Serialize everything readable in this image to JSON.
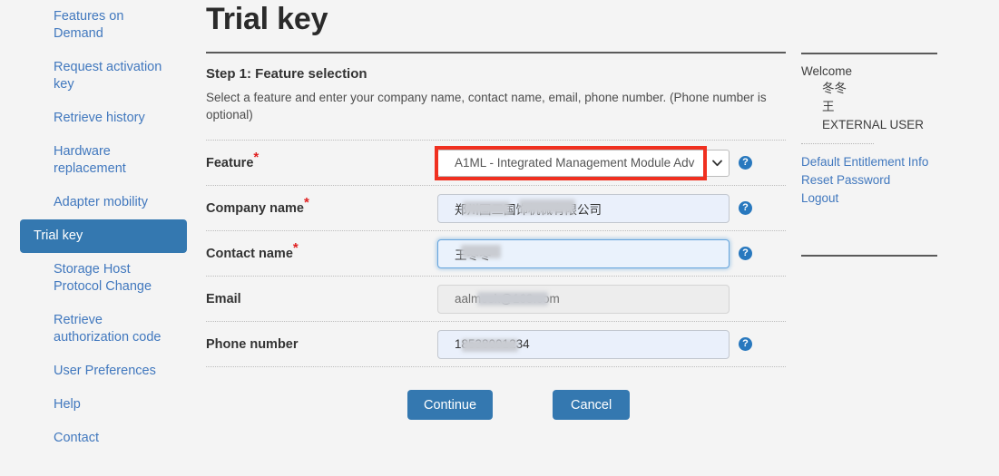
{
  "sidebar": {
    "items": [
      {
        "label": "Features on Demand",
        "active": false
      },
      {
        "label": "Request activation key",
        "active": false
      },
      {
        "label": "Retrieve history",
        "active": false
      },
      {
        "label": "Hardware replacement",
        "active": false
      },
      {
        "label": "Adapter mobility",
        "active": false
      },
      {
        "label": "Trial key",
        "active": true
      },
      {
        "label": "Storage Host Protocol Change",
        "active": false
      },
      {
        "label": "Retrieve authorization code",
        "active": false
      },
      {
        "label": "User Preferences",
        "active": false
      },
      {
        "label": "Help",
        "active": false
      },
      {
        "label": "Contact",
        "active": false
      }
    ]
  },
  "main": {
    "page_title": "Trial key",
    "step_heading": "Step 1: Feature selection",
    "step_description": "Select a feature and enter your company name, contact name, email, phone number. (Phone number is optional)",
    "fields": {
      "feature": {
        "label": "Feature",
        "required": true,
        "value": "A1ML - Integrated Management Module Adv",
        "help_icon": "question-circle-icon",
        "dropdown_icon": "chevron-down-icon",
        "highlighted": true
      },
      "company_name": {
        "label": "Company name",
        "required": true,
        "value": "郑州国三国饰机械有限公司",
        "help_icon": "question-circle-icon",
        "redacted": true
      },
      "contact_name": {
        "label": "Contact name",
        "required": true,
        "value": "王冬冬",
        "help_icon": "question-circle-icon",
        "focused": true,
        "redacted": true
      },
      "email": {
        "label": "Email",
        "required": false,
        "value": "aalmosk@163.com",
        "disabled": true,
        "redacted": true
      },
      "phone_number": {
        "label": "Phone number",
        "required": false,
        "value": "18538001234",
        "help_icon": "question-circle-icon",
        "redacted": true
      }
    },
    "buttons": {
      "continue": "Continue",
      "cancel": "Cancel"
    }
  },
  "right_panel": {
    "welcome_label": "Welcome",
    "user_lines": [
      "冬冬",
      "王",
      "EXTERNAL USER"
    ],
    "links": [
      "Default Entitlement Info",
      "Reset Password",
      "Logout"
    ]
  },
  "colors": {
    "accent_blue": "#3478b0",
    "link_blue": "#4178be",
    "required_red": "#e02020",
    "highlight_red": "#f03020",
    "page_background": "#f4f4f4",
    "input_blue_fill": "#eaf0fb",
    "disabled_fill": "#ededed"
  }
}
